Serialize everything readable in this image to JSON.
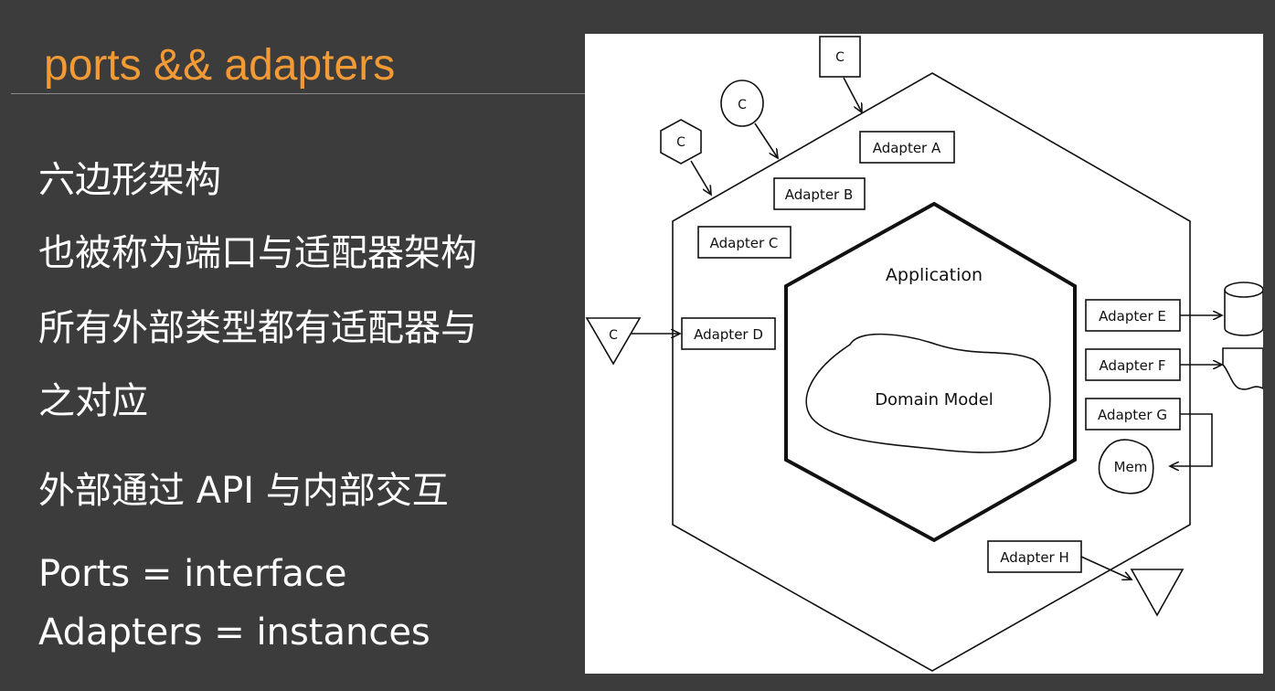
{
  "slide": {
    "title": "ports && adapters",
    "bullets": [
      "六边形架构",
      "也被称为端口与适配器架构",
      "所有外部类型都有适配器与",
      "之对应",
      "外部通过 API 与内部交互",
      "Ports = interface",
      "Adapters = instances"
    ]
  },
  "diagram": {
    "application_label": "Application",
    "domain_model_label": "Domain Model",
    "adapters": {
      "a": "Adapter A",
      "b": "Adapter B",
      "c": "Adapter C",
      "d": "Adapter D",
      "e": "Adapter E",
      "f": "Adapter F",
      "g": "Adapter G",
      "h": "Adapter H"
    },
    "clients": {
      "square": "C",
      "oval": "C",
      "hexagon": "C",
      "triangle": "C"
    },
    "memory_label": "Mem"
  }
}
